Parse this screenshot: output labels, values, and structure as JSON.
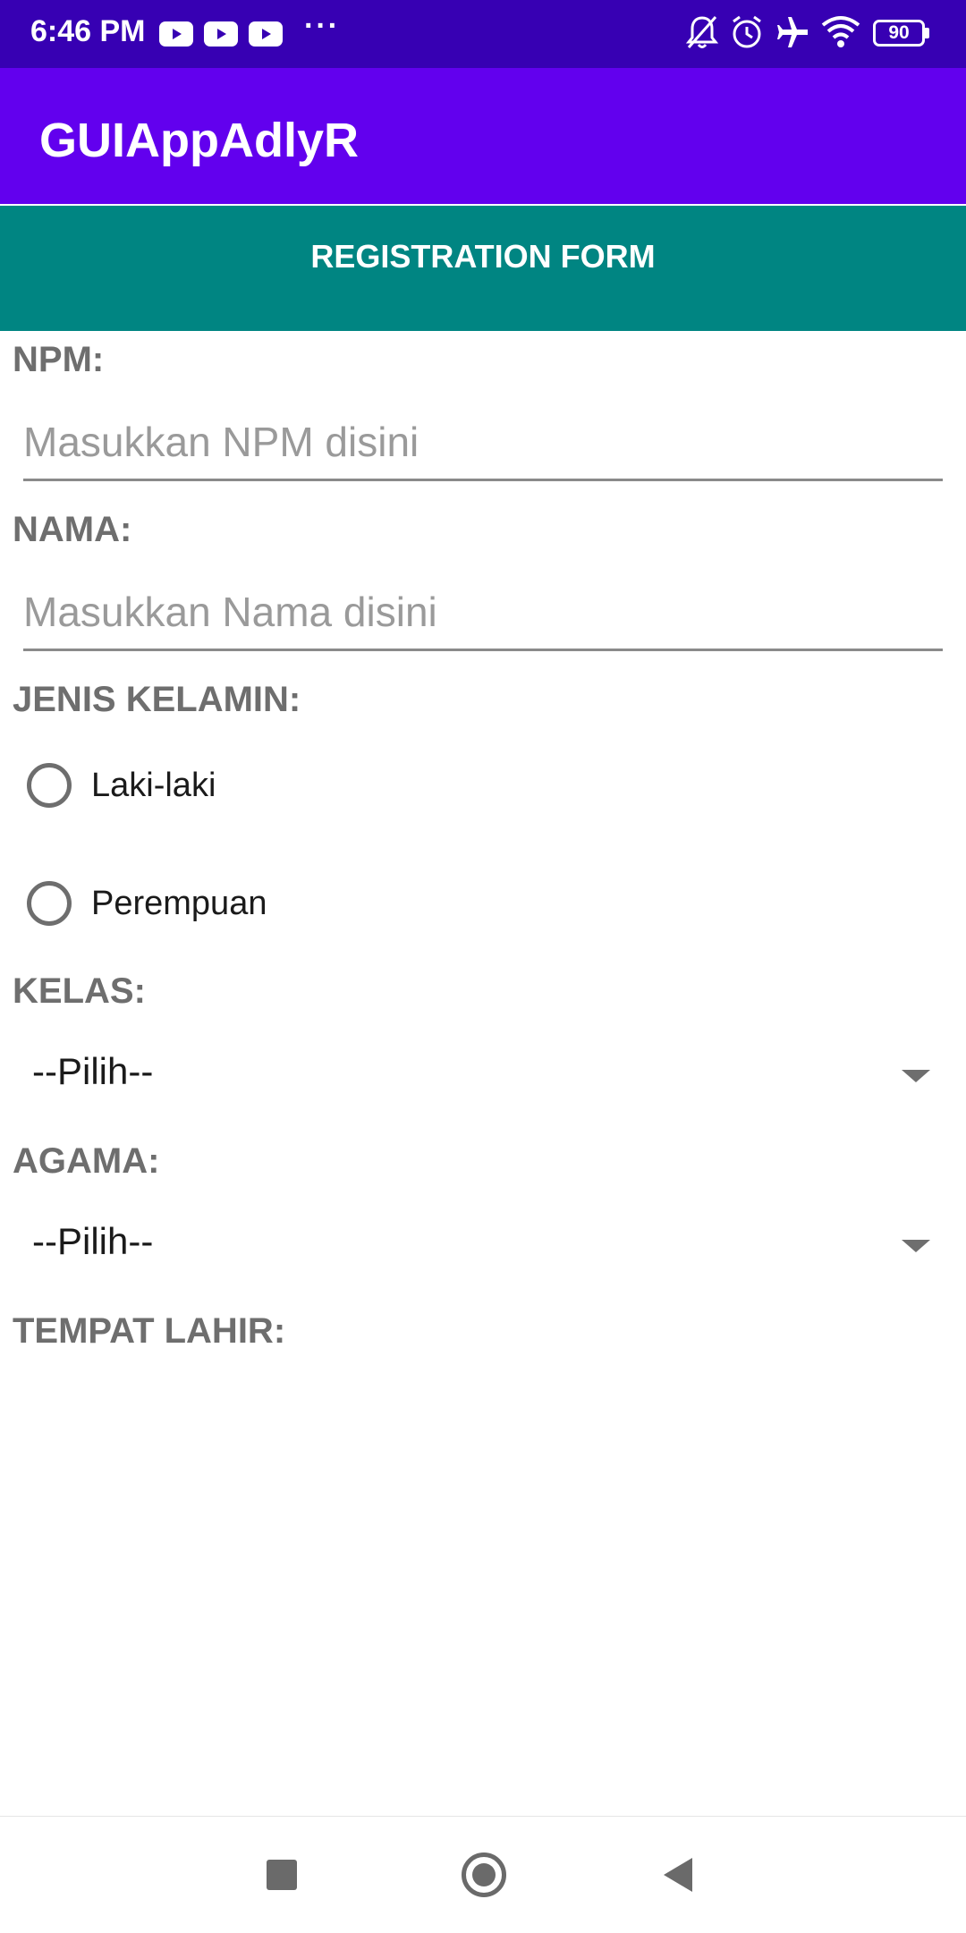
{
  "status_bar": {
    "time": "6:46 PM",
    "overflow_indicator": "···",
    "notification_icons": [
      "youtube-icon",
      "youtube-icon",
      "youtube-icon"
    ],
    "right_icons": [
      "bell-off-icon",
      "alarm-icon",
      "airplane-icon",
      "wifi-icon",
      "battery-icon"
    ],
    "battery_level": "90"
  },
  "app_bar": {
    "title": "GUIAppAdlyR"
  },
  "form": {
    "header": "REGISTRATION FORM",
    "npm_label": "NPM:",
    "npm_placeholder": "Masukkan NPM disini",
    "nama_label": "NAMA:",
    "nama_placeholder": "Masukkan Nama disini",
    "gender_label": "JENIS KELAMIN:",
    "gender_options": [
      "Laki-laki",
      "Perempuan"
    ],
    "kelas_label": "KELAS:",
    "kelas_value": "--Pilih--",
    "agama_label": "AGAMA:",
    "agama_value": "--Pilih--",
    "tempat_lahir_label": "TEMPAT LAHIR:"
  },
  "nav_bar": {
    "icons": [
      "recents-icon",
      "home-icon",
      "back-icon"
    ]
  },
  "colors": {
    "status_bar": "#3700b3",
    "app_bar": "#6200ee",
    "form_header": "#008582",
    "label_text": "#6e6e6e"
  }
}
